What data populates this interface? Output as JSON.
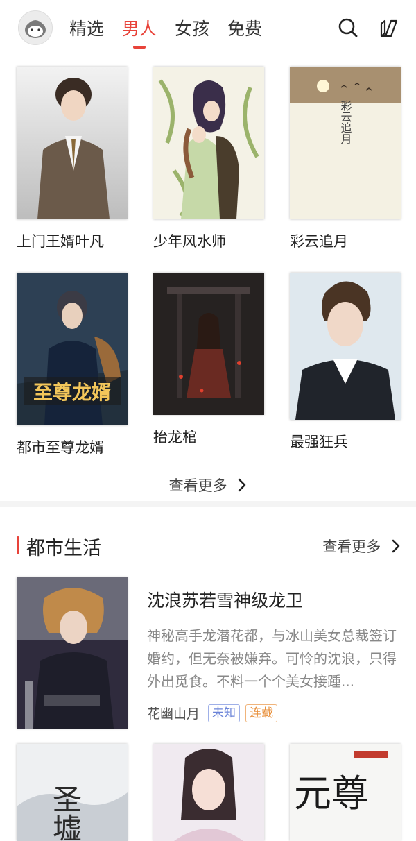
{
  "header": {
    "tabs": [
      {
        "label": "精选",
        "active": false
      },
      {
        "label": "男人",
        "active": true
      },
      {
        "label": "女孩",
        "active": false
      },
      {
        "label": "免费",
        "active": false
      }
    ],
    "icons": [
      "avatar",
      "search-icon",
      "bookshelf-icon"
    ],
    "accent_color": "#e8433a"
  },
  "grid_books": [
    {
      "title": "上门王婿叶凡"
    },
    {
      "title": "少年风水师"
    },
    {
      "title": "彩云追月",
      "cover_text": "彩云追月"
    },
    {
      "title": "都市至尊龙婿",
      "cover_text": "至尊龙婿"
    },
    {
      "title": "抬龙棺"
    },
    {
      "title": "最强狂兵"
    }
  ],
  "grid_more_label": "查看更多",
  "section": {
    "title": "都市生活",
    "more_label": "查看更多"
  },
  "featured": {
    "title": "沈浪苏若雪神级龙卫",
    "description": "神秘高手龙潜花都，与冰山美女总裁签订婚约，但无奈被嫌弃。可怜的沈浪，只得外出觅食。不料一个个美女接踵...",
    "author": "花幽山月",
    "tags": [
      "未知",
      "连载"
    ]
  },
  "bottom_books": [
    {
      "cover_text": "圣墟"
    },
    {
      "cover_text": ""
    },
    {
      "cover_text": "元尊"
    }
  ]
}
